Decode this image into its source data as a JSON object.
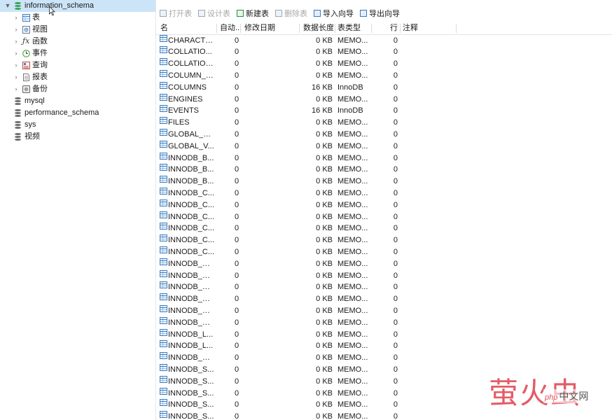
{
  "tree": {
    "root": {
      "label": "information_schema",
      "expanded": true
    },
    "children": [
      {
        "label": "表",
        "icon": "table-icon"
      },
      {
        "label": "视图",
        "icon": "view-icon"
      },
      {
        "label": "函数",
        "icon": "function-icon"
      },
      {
        "label": "事件",
        "icon": "event-icon"
      },
      {
        "label": "查询",
        "icon": "query-icon"
      },
      {
        "label": "报表",
        "icon": "report-icon"
      },
      {
        "label": "备份",
        "icon": "backup-icon"
      }
    ],
    "databases": [
      {
        "label": "mysql"
      },
      {
        "label": "performance_schema"
      },
      {
        "label": "sys"
      },
      {
        "label": "视频"
      }
    ]
  },
  "toolbar": {
    "open_table": "打开表",
    "design_table": "设计表",
    "new_table": "新建表",
    "delete_table": "删除表",
    "import_wizard": "导入向导",
    "export_wizard": "导出向导"
  },
  "grid": {
    "columns": {
      "name": "名",
      "auto_increment": "自动...",
      "modified_date": "修改日期",
      "data_length": "数据长度",
      "table_type": "表类型",
      "rows": "行",
      "comment": "注释"
    },
    "rows": [
      {
        "name": "CHARACTE...",
        "auto": "0",
        "size": "0 KB",
        "engine": "MEMO...",
        "rows": "0"
      },
      {
        "name": "COLLATIO...",
        "auto": "0",
        "size": "0 KB",
        "engine": "MEMO...",
        "rows": "0"
      },
      {
        "name": "COLLATIONS",
        "auto": "0",
        "size": "0 KB",
        "engine": "MEMO...",
        "rows": "0"
      },
      {
        "name": "COLUMN_P...",
        "auto": "0",
        "size": "0 KB",
        "engine": "MEMO...",
        "rows": "0"
      },
      {
        "name": "COLUMNS",
        "auto": "0",
        "size": "16 KB",
        "engine": "InnoDB",
        "rows": "0"
      },
      {
        "name": "ENGINES",
        "auto": "0",
        "size": "0 KB",
        "engine": "MEMO...",
        "rows": "0"
      },
      {
        "name": "EVENTS",
        "auto": "0",
        "size": "16 KB",
        "engine": "InnoDB",
        "rows": "0"
      },
      {
        "name": "FILES",
        "auto": "0",
        "size": "0 KB",
        "engine": "MEMO...",
        "rows": "0"
      },
      {
        "name": "GLOBAL_ST...",
        "auto": "0",
        "size": "0 KB",
        "engine": "MEMO...",
        "rows": "0"
      },
      {
        "name": "GLOBAL_V...",
        "auto": "0",
        "size": "0 KB",
        "engine": "MEMO...",
        "rows": "0"
      },
      {
        "name": "INNODB_B...",
        "auto": "0",
        "size": "0 KB",
        "engine": "MEMO...",
        "rows": "0"
      },
      {
        "name": "INNODB_B...",
        "auto": "0",
        "size": "0 KB",
        "engine": "MEMO...",
        "rows": "0"
      },
      {
        "name": "INNODB_B...",
        "auto": "0",
        "size": "0 KB",
        "engine": "MEMO...",
        "rows": "0"
      },
      {
        "name": "INNODB_C...",
        "auto": "0",
        "size": "0 KB",
        "engine": "MEMO...",
        "rows": "0"
      },
      {
        "name": "INNODB_C...",
        "auto": "0",
        "size": "0 KB",
        "engine": "MEMO...",
        "rows": "0"
      },
      {
        "name": "INNODB_C...",
        "auto": "0",
        "size": "0 KB",
        "engine": "MEMO...",
        "rows": "0"
      },
      {
        "name": "INNODB_C...",
        "auto": "0",
        "size": "0 KB",
        "engine": "MEMO...",
        "rows": "0"
      },
      {
        "name": "INNODB_C...",
        "auto": "0",
        "size": "0 KB",
        "engine": "MEMO...",
        "rows": "0"
      },
      {
        "name": "INNODB_C...",
        "auto": "0",
        "size": "0 KB",
        "engine": "MEMO...",
        "rows": "0"
      },
      {
        "name": "INNODB_FT...",
        "auto": "0",
        "size": "0 KB",
        "engine": "MEMO...",
        "rows": "0"
      },
      {
        "name": "INNODB_FT...",
        "auto": "0",
        "size": "0 KB",
        "engine": "MEMO...",
        "rows": "0"
      },
      {
        "name": "INNODB_FT...",
        "auto": "0",
        "size": "0 KB",
        "engine": "MEMO...",
        "rows": "0"
      },
      {
        "name": "INNODB_FT...",
        "auto": "0",
        "size": "0 KB",
        "engine": "MEMO...",
        "rows": "0"
      },
      {
        "name": "INNODB_FT...",
        "auto": "0",
        "size": "0 KB",
        "engine": "MEMO...",
        "rows": "0"
      },
      {
        "name": "INNODB_FT...",
        "auto": "0",
        "size": "0 KB",
        "engine": "MEMO...",
        "rows": "0"
      },
      {
        "name": "INNODB_L...",
        "auto": "0",
        "size": "0 KB",
        "engine": "MEMO...",
        "rows": "0"
      },
      {
        "name": "INNODB_L...",
        "auto": "0",
        "size": "0 KB",
        "engine": "MEMO...",
        "rows": "0"
      },
      {
        "name": "INNODB_M...",
        "auto": "0",
        "size": "0 KB",
        "engine": "MEMO...",
        "rows": "0"
      },
      {
        "name": "INNODB_S...",
        "auto": "0",
        "size": "0 KB",
        "engine": "MEMO...",
        "rows": "0"
      },
      {
        "name": "INNODB_S...",
        "auto": "0",
        "size": "0 KB",
        "engine": "MEMO...",
        "rows": "0"
      },
      {
        "name": "INNODB_S...",
        "auto": "0",
        "size": "0 KB",
        "engine": "MEMO...",
        "rows": "0"
      },
      {
        "name": "INNODB_S...",
        "auto": "0",
        "size": "0 KB",
        "engine": "MEMO...",
        "rows": "0"
      },
      {
        "name": "INNODB_S...",
        "auto": "0",
        "size": "0 KB",
        "engine": "MEMO...",
        "rows": "0"
      }
    ]
  },
  "watermark": {
    "main": "萤火虫",
    "php": "php",
    "small": "中文网"
  },
  "colors": {
    "selection": "#cce4f7",
    "db_active": "#3aa35a",
    "db_inactive": "#6e6e6e",
    "watermark": "#e04b57"
  }
}
